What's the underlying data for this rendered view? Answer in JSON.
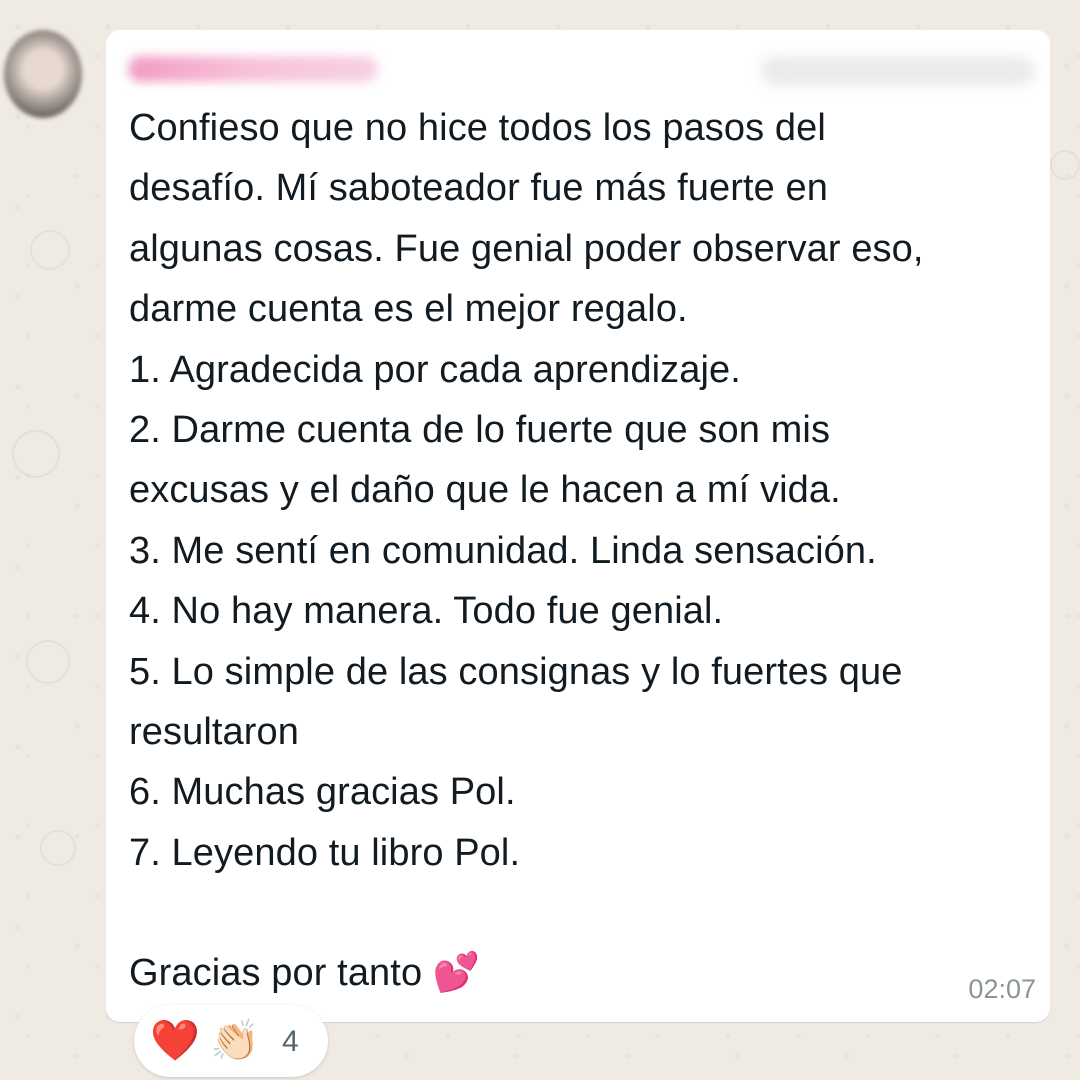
{
  "message": {
    "lines": [
      "Confieso que no hice todos los pasos del",
      "desafío. Mí saboteador fue más fuerte en",
      "algunas cosas. Fue genial poder observar eso,",
      "darme cuenta es el mejor regalo.",
      "1. Agradecida por cada aprendizaje.",
      "2. Darme cuenta de lo fuerte que son mis",
      "excusas y el daño que le hacen a mí vida.",
      "3. Me sentí en comunidad. Linda sensación.",
      "4. No hay manera. Todo fue genial.",
      "5. Lo simple de las consignas y lo fuertes que",
      "resultaron",
      "6. Muchas gracias Pol.",
      "7. Leyendo tu libro Pol.",
      "",
      "Gracias por tanto 💕"
    ],
    "time": "02:07"
  },
  "reactions": {
    "emojis": [
      "❤️",
      "👏🏻"
    ],
    "count": "4"
  },
  "colors": {
    "wallpaper": "#efeae2",
    "bubble": "#ffffff",
    "text": "#111b21",
    "time": "#8a9499"
  }
}
